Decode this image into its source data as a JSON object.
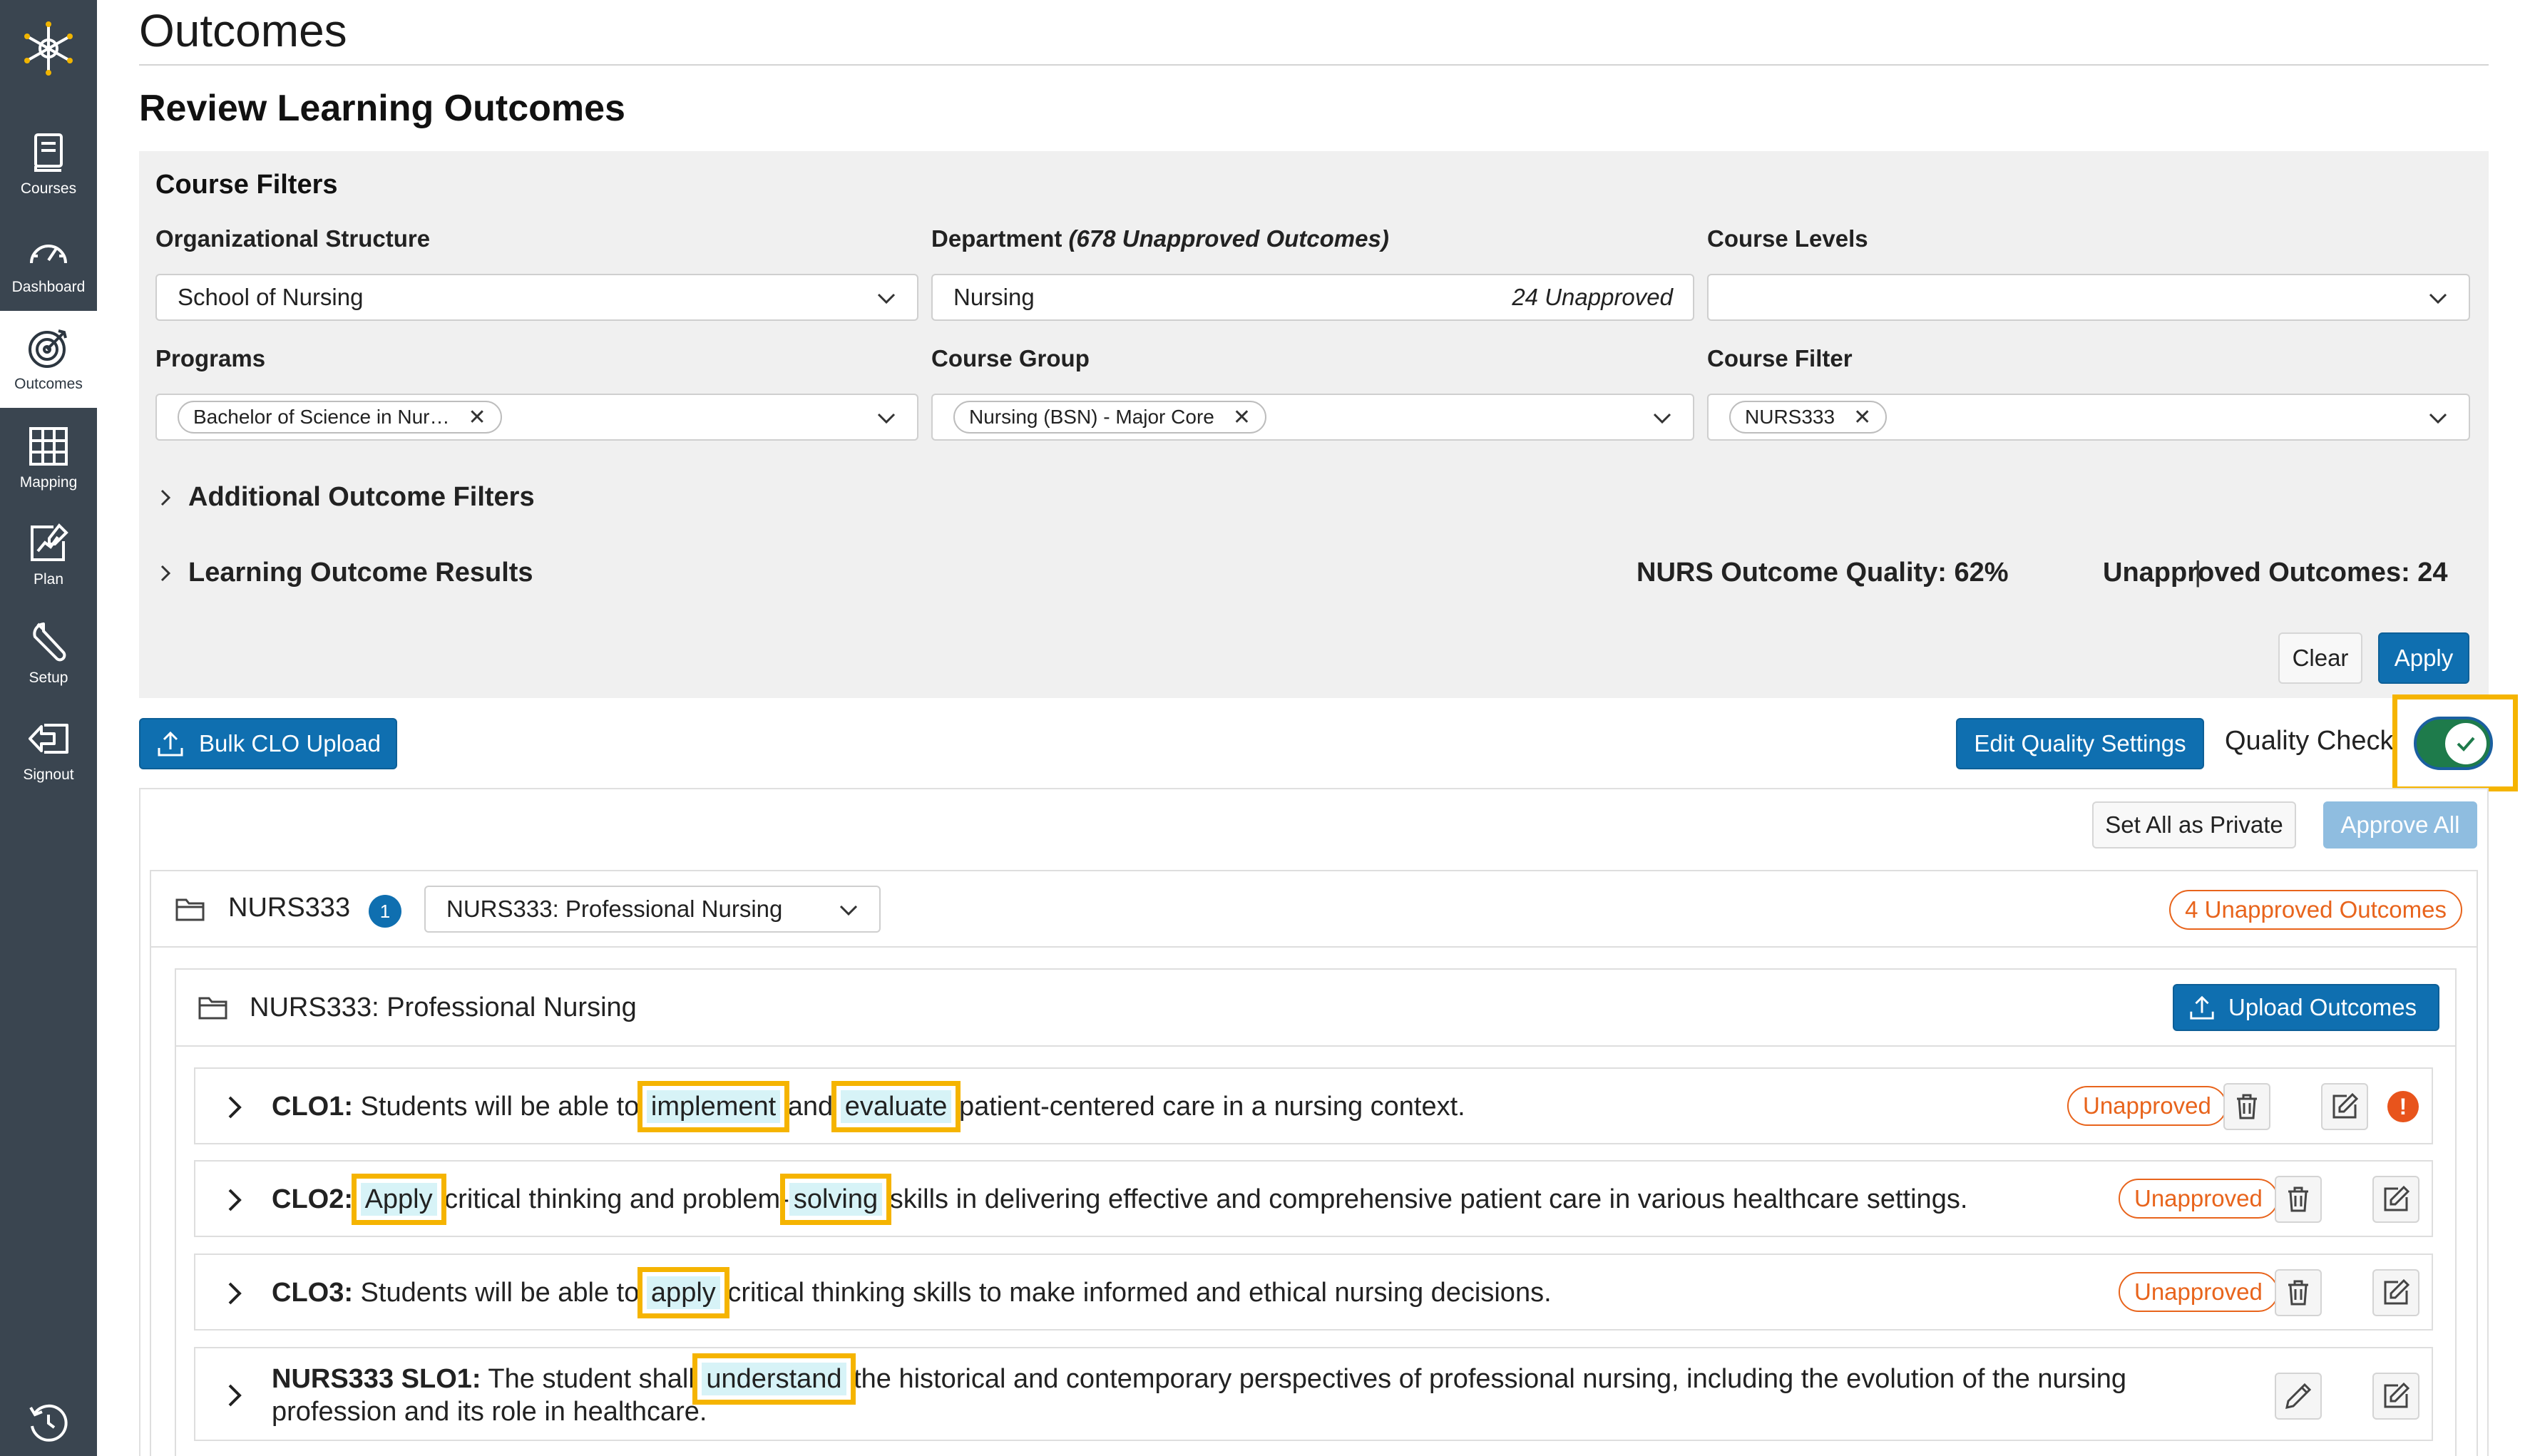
{
  "sidebar": {
    "items": [
      {
        "label": "Courses",
        "icon": "book-icon"
      },
      {
        "label": "Dashboard",
        "icon": "gauge-icon"
      },
      {
        "label": "Outcomes",
        "icon": "target-icon"
      },
      {
        "label": "Mapping",
        "icon": "grid-icon"
      },
      {
        "label": "Plan",
        "icon": "edit-chart-icon"
      },
      {
        "label": "Setup",
        "icon": "wrench-icon"
      },
      {
        "label": "Signout",
        "icon": "signout-icon"
      }
    ],
    "active": "Outcomes"
  },
  "header": {
    "title": "Outcomes",
    "subtitle": "Review Learning Outcomes"
  },
  "filters": {
    "title": "Course Filters",
    "org_label": "Organizational Structure",
    "org_value": "School of Nursing",
    "dept_label": "Department",
    "dept_note": "(678 Unapproved Outcomes)",
    "dept_value": "Nursing",
    "dept_unapproved": "24 Unapproved",
    "levels_label": "Course Levels",
    "levels_value": "",
    "programs_label": "Programs",
    "programs_chip": "Bachelor of Science in Nur…",
    "group_label": "Course Group",
    "group_chip": "Nursing (BSN) - Major Core",
    "course_filter_label": "Course Filter",
    "course_filter_chip": "NURS333",
    "additional": "Additional Outcome Filters",
    "results": "Learning Outcome Results",
    "quality": "NURS Outcome Quality: 62%",
    "separator": "|",
    "unapproved_total": "Unapproved Outcomes: 24",
    "clear": "Clear",
    "apply": "Apply"
  },
  "toolbar": {
    "bulk_upload": "Bulk CLO Upload",
    "edit_quality": "Edit Quality Settings",
    "quality_check": "Quality Check",
    "quality_check_on": true,
    "set_private": "Set All as Private",
    "approve_all": "Approve All"
  },
  "course": {
    "code": "NURS333",
    "count": "1",
    "select_value": "NURS333: Professional Nursing",
    "unapproved_pill": "4 Unapproved Outcomes",
    "section_name": "NURS333: Professional Nursing",
    "upload_outcomes": "Upload Outcomes"
  },
  "outcomes": [
    {
      "id": "CLO1:",
      "parts": [
        " Students will be able to ",
        "implement",
        " and ",
        "evaluate",
        " patient-centered care in a nursing context."
      ],
      "status": "Unapproved",
      "warning": "!"
    },
    {
      "id": "CLO2:",
      "parts": [
        " ",
        "Apply",
        " critical thinking and problem-",
        "solving",
        " skills in delivering effective and comprehensive patient care in various healthcare settings."
      ],
      "status": "Unapproved"
    },
    {
      "id": "CLO3:",
      "parts": [
        " Students will be able to ",
        "apply",
        " critical thinking skills to make informed and ethical nursing decisions."
      ],
      "status": "Unapproved"
    },
    {
      "id": "NURS333 SLO1:",
      "parts": [
        " The student shall ",
        "understand",
        " the historical and contemporary perspectives of professional nursing, including the evolution of the nursing",
        "profession and its role in healthcare."
      ]
    }
  ],
  "colors": {
    "primary": "#0f6fb0",
    "sidebar": "#3a4550",
    "highlight_border": "#f5b400",
    "highlight_fill": "#d7f3f7",
    "unapproved": "#e8641c",
    "toggle_on": "#1e7b4b"
  }
}
